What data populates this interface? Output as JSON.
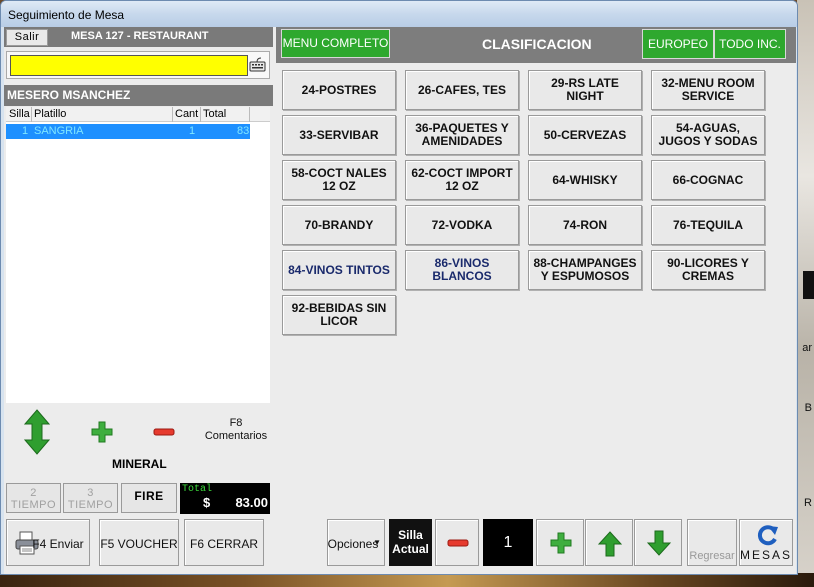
{
  "window": {
    "title": "Seguimiento de Mesa"
  },
  "left": {
    "salir_label": "Salir",
    "mesa_label": "MESA 127 - RESTAURANT",
    "search": {
      "value": "",
      "placeholder": ""
    },
    "waiter_label": "MESERO MSANCHEZ",
    "order": {
      "columns": [
        "Silla",
        "Platillo",
        "Cant",
        "Total"
      ],
      "rows": [
        {
          "silla": "1",
          "platillo": "SANGRIA",
          "cant": "1",
          "total": "83"
        }
      ]
    },
    "f8_label": "F8",
    "comentarios_label": "Comentarios",
    "selected_item": "MINERAL",
    "tiempo2_num": "2",
    "tiempo2_label": "TIEMPO",
    "tiempo3_num": "3",
    "tiempo3_label": "TIEMPO",
    "fire_label": "FIRE",
    "total_label": "Total",
    "total_currency": "$",
    "total_amount": "83.00"
  },
  "right": {
    "menu_completo_label": "MENU COMPLETO",
    "clasificacion_label": "CLASIFICACION",
    "europeo_label": "EUROPEO",
    "todo_inc_label": "TODO INC.",
    "categories": [
      "24-POSTRES",
      "26-CAFES, TES",
      "29-RS LATE NIGHT",
      "32-MENU ROOM SERVICE",
      "33-SERVIBAR",
      "36-PAQUETES Y AMENIDADES",
      "50-CERVEZAS",
      "54-AGUAS, JUGOS Y SODAS",
      "58-COCT NALES 12 OZ",
      "62-COCT IMPORT 12 OZ",
      "64-WHISKY",
      "66-COGNAC",
      "70-BRANDY",
      "72-VODKA",
      "74-RON",
      "76-TEQUILA",
      "84-VINOS TINTOS",
      "86-VINOS BLANCOS",
      "88-CHAMPANGES Y ESPUMOSOS",
      "90-LICORES Y CREMAS",
      "92-BEBIDAS SIN LICOR"
    ]
  },
  "bottom": {
    "f4_label": "F4 Enviar",
    "f5_label": "F5 VOUCHER",
    "f6_label": "F6 CERRAR",
    "opciones_label": "Opciones",
    "silla_actual_label": "Silla Actual",
    "seat_number": "1",
    "regresar_label": "Regresar",
    "mesas_label": "MESAS"
  },
  "background": {
    "frag1": "ar",
    "frag2": "B",
    "frag3": "R"
  },
  "colors": {
    "accent_green": "#2ea82e",
    "search_yellow": "#ffff00",
    "selected_row": "#1e90ff",
    "header_gray": "#7a7a7a"
  }
}
